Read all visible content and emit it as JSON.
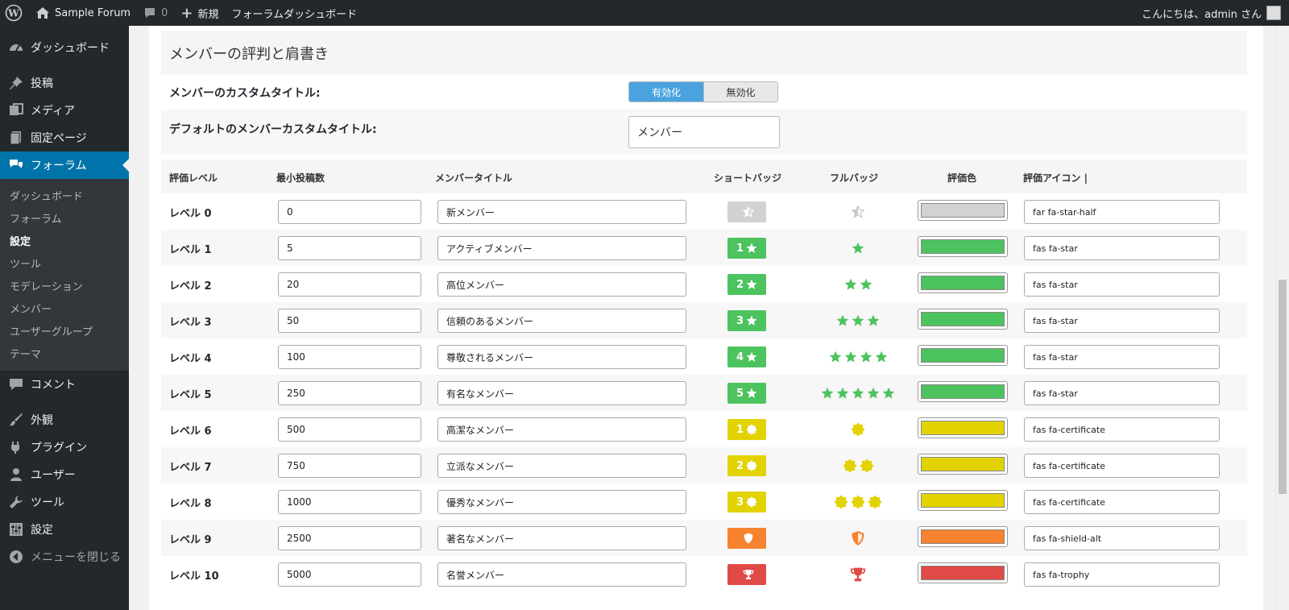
{
  "adminbar": {
    "site_name": "Sample Forum",
    "comments_count": "0",
    "new_label": "新規",
    "dashboard_link": "フォーラムダッシュボード",
    "greeting": "こんにちは、admin さん"
  },
  "sidebar": {
    "items": [
      {
        "label": "ダッシュボード",
        "icon": "dashboard-icon"
      },
      {
        "label": "投稿",
        "icon": "pin-icon"
      },
      {
        "label": "メディア",
        "icon": "media-icon"
      },
      {
        "label": "固定ページ",
        "icon": "page-icon"
      },
      {
        "label": "フォーラム",
        "icon": "forum-icon"
      }
    ],
    "submenu": [
      "ダッシュボード",
      "フォーラム",
      "設定",
      "ツール",
      "モデレーション",
      "メンバー",
      "ユーザーグループ",
      "テーマ"
    ],
    "items_after": [
      {
        "label": "コメント",
        "icon": "comment-icon"
      },
      {
        "label": "外観",
        "icon": "brush-icon"
      },
      {
        "label": "プラグイン",
        "icon": "plugin-icon"
      },
      {
        "label": "ユーザー",
        "icon": "user-icon"
      },
      {
        "label": "ツール",
        "icon": "wrench-icon"
      },
      {
        "label": "設定",
        "icon": "settings-icon"
      },
      {
        "label": "メニューを閉じる",
        "icon": "collapse-icon"
      }
    ]
  },
  "section": {
    "title": "メンバーの評判と肩書き",
    "custom_title_label": "メンバーのカスタムタイトル:",
    "enable_label": "有効化",
    "disable_label": "無効化",
    "default_title_label": "デフォルトのメンバーカスタムタイトル:",
    "default_title_value": "メンバー"
  },
  "table": {
    "headers": {
      "level": "評価レベル",
      "min_posts": "最小投稿数",
      "title": "メンバータイトル",
      "short_badge": "ショートバッジ",
      "full_badge": "フルバッジ",
      "color": "評価色",
      "icon": "評価アイコン |"
    },
    "rows": [
      {
        "level": "レベル 0",
        "min_posts": "0",
        "title": "新メンバー",
        "short_num": "",
        "full_count": 1,
        "color": "#d2d2d2",
        "icon": "far fa-star-half",
        "glyph": "star-half-icon"
      },
      {
        "level": "レベル 1",
        "min_posts": "5",
        "title": "アクティブメンバー",
        "short_num": "1",
        "full_count": 1,
        "color": "#4dc35f",
        "icon": "fas fa-star",
        "glyph": "star-icon"
      },
      {
        "level": "レベル 2",
        "min_posts": "20",
        "title": "高位メンバー",
        "short_num": "2",
        "full_count": 2,
        "color": "#4dc35f",
        "icon": "fas fa-star",
        "glyph": "star-icon"
      },
      {
        "level": "レベル 3",
        "min_posts": "50",
        "title": "信頼のあるメンバー",
        "short_num": "3",
        "full_count": 3,
        "color": "#4dc35f",
        "icon": "fas fa-star",
        "glyph": "star-icon"
      },
      {
        "level": "レベル 4",
        "min_posts": "100",
        "title": "尊敬されるメンバー",
        "short_num": "4",
        "full_count": 4,
        "color": "#4dc35f",
        "icon": "fas fa-star",
        "glyph": "star-icon"
      },
      {
        "level": "レベル 5",
        "min_posts": "250",
        "title": "有名なメンバー",
        "short_num": "5",
        "full_count": 5,
        "color": "#4dc35f",
        "icon": "fas fa-star",
        "glyph": "star-icon"
      },
      {
        "level": "レベル 6",
        "min_posts": "500",
        "title": "高潔なメンバー",
        "short_num": "1",
        "full_count": 1,
        "color": "#e2d300",
        "icon": "fas fa-certificate",
        "glyph": "certificate-icon"
      },
      {
        "level": "レベル 7",
        "min_posts": "750",
        "title": "立派なメンバー",
        "short_num": "2",
        "full_count": 2,
        "color": "#e2d300",
        "icon": "fas fa-certificate",
        "glyph": "certificate-icon"
      },
      {
        "level": "レベル 8",
        "min_posts": "1000",
        "title": "優秀なメンバー",
        "short_num": "3",
        "full_count": 3,
        "color": "#e2d300",
        "icon": "fas fa-certificate",
        "glyph": "certificate-icon"
      },
      {
        "level": "レベル 9",
        "min_posts": "2500",
        "title": "著名なメンバー",
        "short_num": "",
        "full_count": 1,
        "color": "#f7822f",
        "icon": "fas fa-shield-alt",
        "glyph": "shield-icon"
      },
      {
        "level": "レベル 10",
        "min_posts": "5000",
        "title": "名誉メンバー",
        "short_num": "",
        "full_count": 1,
        "color": "#df4a47",
        "icon": "fas fa-trophy",
        "glyph": "trophy-icon"
      }
    ]
  }
}
